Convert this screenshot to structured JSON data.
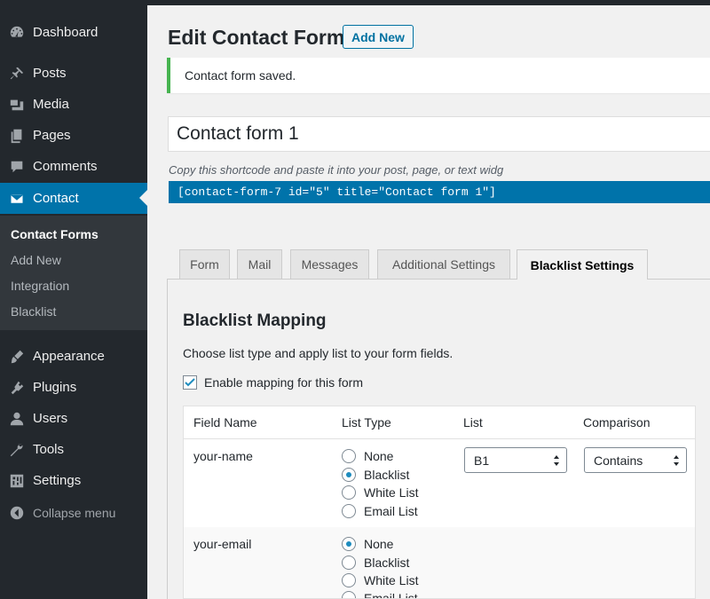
{
  "sidebar": {
    "items": [
      {
        "label": "Dashboard",
        "icon": "dashboard-icon"
      },
      {
        "label": "Posts",
        "icon": "pin-icon"
      },
      {
        "label": "Media",
        "icon": "media-icon"
      },
      {
        "label": "Pages",
        "icon": "pages-icon"
      },
      {
        "label": "Comments",
        "icon": "comment-icon"
      },
      {
        "label": "Contact",
        "icon": "envelope-icon"
      },
      {
        "label": "Appearance",
        "icon": "paintbrush-icon"
      },
      {
        "label": "Plugins",
        "icon": "plugin-icon"
      },
      {
        "label": "Users",
        "icon": "user-icon"
      },
      {
        "label": "Tools",
        "icon": "wrench-icon"
      },
      {
        "label": "Settings",
        "icon": "settings-icon"
      }
    ],
    "submenu": [
      "Contact Forms",
      "Add New",
      "Integration",
      "Blacklist"
    ],
    "collapse": "Collapse menu"
  },
  "header": {
    "title": "Edit Contact Form",
    "add_new": "Add New"
  },
  "notice": "Contact form saved.",
  "form_title": "Contact form 1",
  "shortcode_desc": "Copy this shortcode and paste it into your post, page, or text widg",
  "shortcode": "[contact-form-7 id=\"5\" title=\"Contact form 1\"]",
  "tabs": [
    "Form",
    "Mail",
    "Messages",
    "Additional Settings",
    "Blacklist Settings"
  ],
  "mapping": {
    "title": "Blacklist Mapping",
    "desc": "Choose list type and apply list to your form fields.",
    "enable_label": "Enable mapping for this form",
    "enabled": true,
    "columns": [
      "Field Name",
      "List Type",
      "List",
      "Comparison"
    ],
    "list_types": [
      "None",
      "Blacklist",
      "White List",
      "Email List"
    ],
    "rows": [
      {
        "field": "your-name",
        "selected_type": "Blacklist",
        "list": "B1",
        "comparison": "Contains"
      },
      {
        "field": "your-email",
        "selected_type": "None"
      }
    ]
  },
  "colors": {
    "sidebar_bg": "#23282d",
    "accent": "#0073aa",
    "notice_border": "#46b450"
  }
}
